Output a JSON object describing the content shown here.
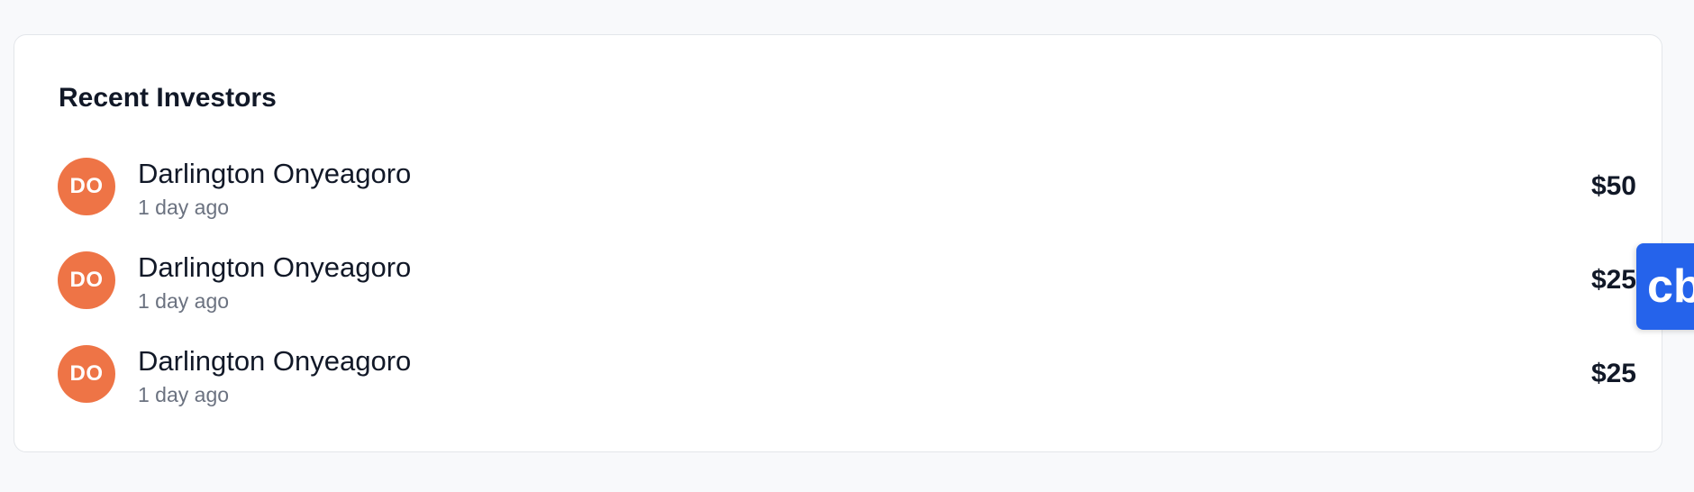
{
  "card": {
    "title": "Recent Investors"
  },
  "investors": [
    {
      "initials": "DO",
      "name": "Darlington Onyeagoro",
      "time": "1 day ago",
      "amount": "$50"
    },
    {
      "initials": "DO",
      "name": "Darlington Onyeagoro",
      "time": "1 day ago",
      "amount": "$25"
    },
    {
      "initials": "DO",
      "name": "Darlington Onyeagoro",
      "time": "1 day ago",
      "amount": "$25"
    }
  ],
  "badge": {
    "text": "cb",
    "color": "#2563eb"
  },
  "colors": {
    "avatar": "#ee7446",
    "text_primary": "#111827",
    "text_muted": "#6b7280"
  }
}
